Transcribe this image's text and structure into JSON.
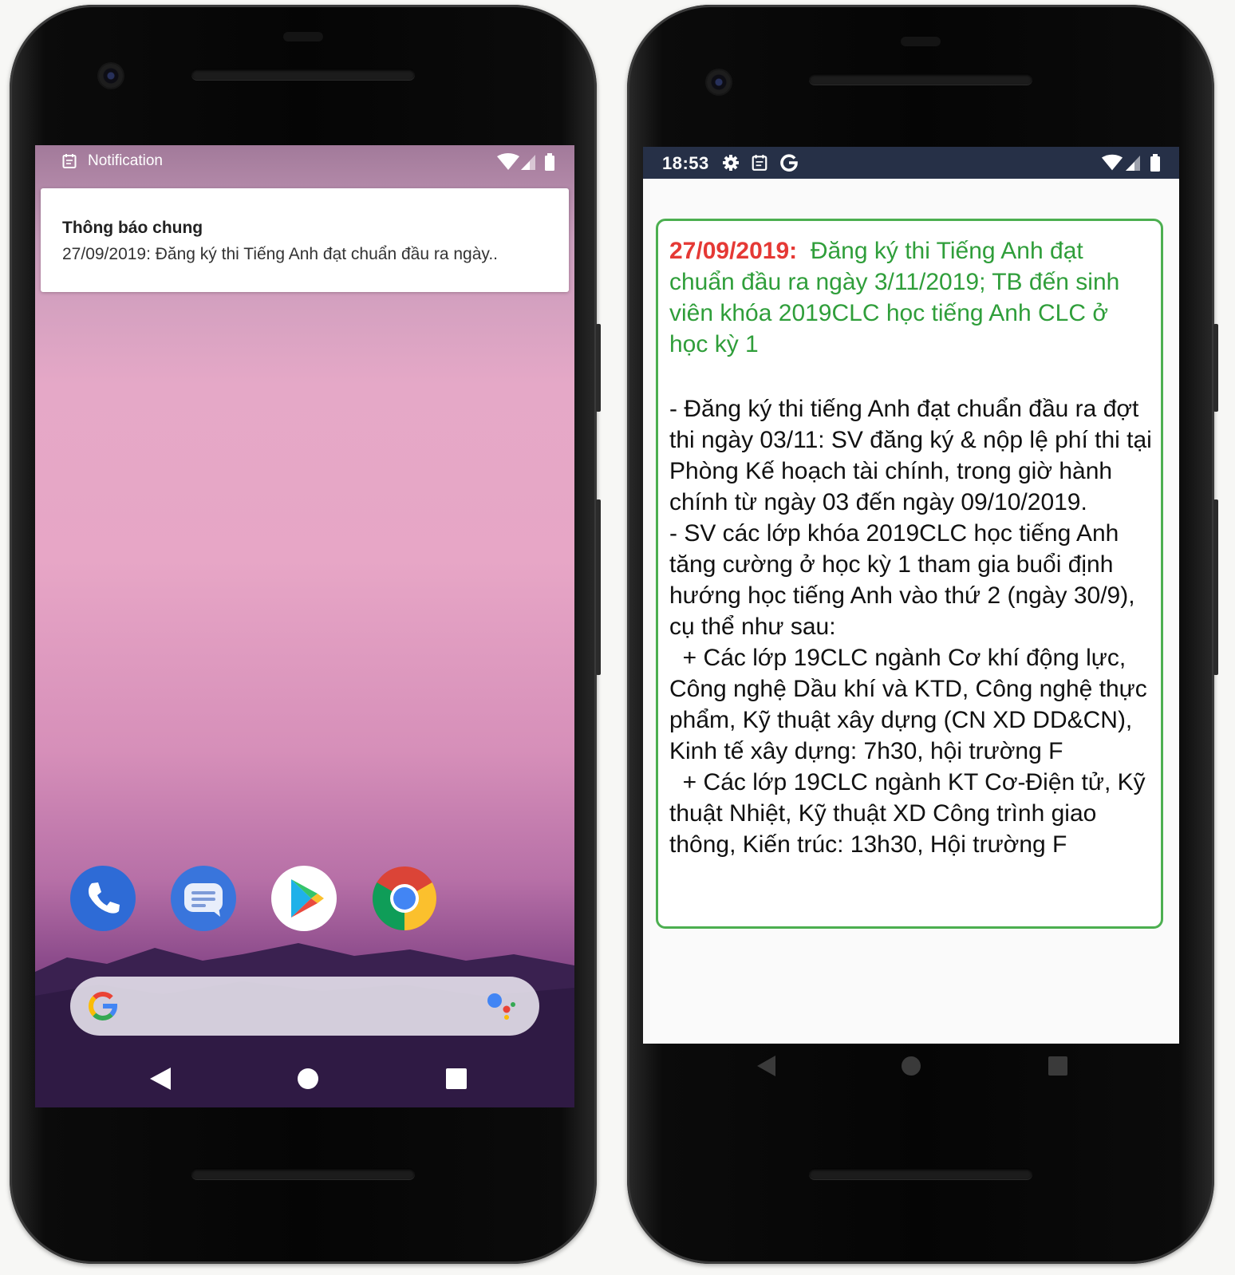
{
  "left_phone": {
    "status_bar": {
      "notification_app": "Notification"
    },
    "notification": {
      "title": "Thông báo chung",
      "text": "27/09/2019:  Đăng ký thi Tiếng Anh đạt chuẩn đầu ra ngày.."
    },
    "dock_apps": [
      "phone-icon",
      "messages-icon",
      "play-store-icon",
      "chrome-icon"
    ],
    "search_widget": {
      "logo": "google-g-icon",
      "assistant": "google-assistant-icon"
    },
    "nav_bar": [
      "back-icon",
      "home-icon",
      "recents-icon"
    ]
  },
  "right_phone": {
    "status_bar": {
      "time": "18:53",
      "icons": [
        "gear-icon",
        "calendar-icon",
        "google-g-icon",
        "wifi-icon",
        "signal-icon",
        "battery-icon"
      ]
    },
    "message": {
      "date": "27/09/2019:",
      "headline": "Đăng ký thi Tiếng Anh đạt chuẩn đầu ra ngày 3/11/2019; TB đến sinh viên khóa 2019CLC học tiếng Anh CLC ở học kỳ 1",
      "body": "- Đăng ký thi tiếng Anh đạt chuẩn đầu ra đợt thi ngày 03/11: SV đăng ký & nộp lệ phí thi tại Phòng Kế hoạch tài chính, trong giờ hành chính từ ngày 03 đến ngày 09/10/2019.\n- SV các lớp khóa 2019CLC học tiếng Anh tăng cường ở học kỳ 1 tham gia buổi định hướng học tiếng Anh vào thứ 2 (ngày 30/9), cụ thể như sau:\n  + Các lớp 19CLC ngành Cơ khí động lực, Công nghệ Dầu khí và KTD, Công nghệ thực phẩm, Kỹ thuật xây dựng (CN XD DD&CN), Kinh tế xây dựng: 7h30, hội trường F\n  + Các lớp 19CLC ngành KT Cơ-Điện tử, Kỹ thuật Nhiệt, Kỹ thuật XD Công trình giao thông, Kiến trúc: 13h30, Hội trường F",
      "colors": {
        "date": "#e53935",
        "headline": "#2f9e3a",
        "border": "#4caf50"
      }
    },
    "nav_bar": [
      "back-icon",
      "home-icon",
      "recents-icon"
    ]
  }
}
